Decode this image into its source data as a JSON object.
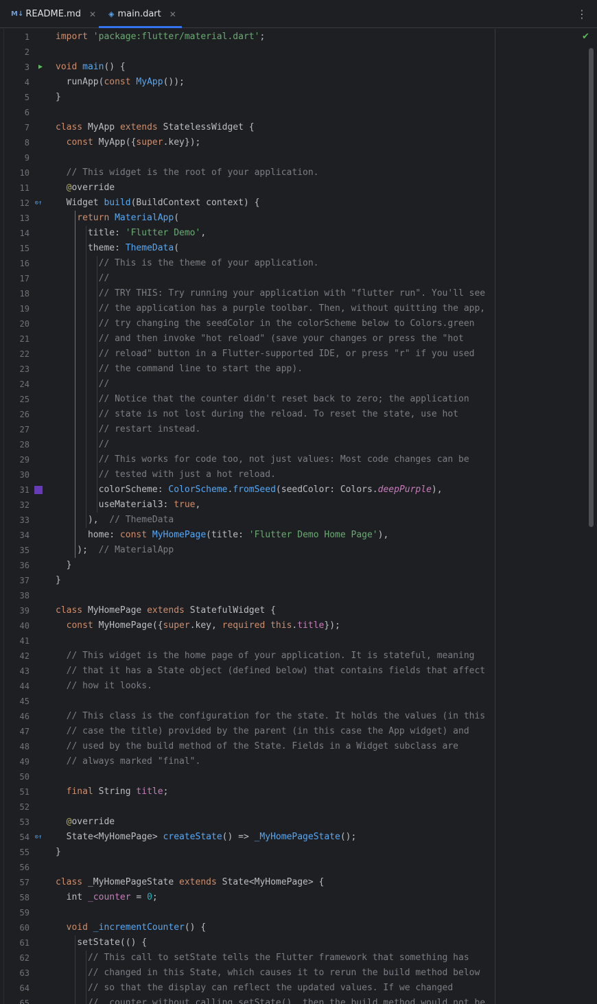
{
  "tabs": [
    {
      "icon": "M↓",
      "label": "README.md",
      "active": false
    },
    {
      "icon": "◈",
      "label": "main.dart",
      "active": true
    }
  ],
  "colors": {
    "accent": "#3574f0",
    "background": "#1e1f22",
    "swatch": "#673ab7"
  },
  "lines": [
    {
      "n": "1",
      "t": [
        [
          "kw",
          "import "
        ],
        [
          "str",
          "'package:flutter/material.dart'"
        ],
        [
          "",
          "; "
        ]
      ]
    },
    {
      "n": "2",
      "t": []
    },
    {
      "n": "3",
      "m": "run",
      "t": [
        [
          "kw",
          "void "
        ],
        [
          "fn",
          "main"
        ],
        [
          "",
          "() {"
        ]
      ]
    },
    {
      "n": "4",
      "t": [
        [
          "",
          "  runApp("
        ],
        [
          "kw",
          "const "
        ],
        [
          "fn",
          "MyApp"
        ],
        [
          "",
          "());"
        ]
      ]
    },
    {
      "n": "5",
      "t": [
        [
          "",
          "}"
        ]
      ]
    },
    {
      "n": "6",
      "t": []
    },
    {
      "n": "7",
      "t": [
        [
          "kw",
          "class "
        ],
        [
          "",
          "MyApp "
        ],
        [
          "kw",
          "extends "
        ],
        [
          "",
          "StatelessWidget {"
        ]
      ]
    },
    {
      "n": "8",
      "t": [
        [
          "kw",
          "  const "
        ],
        [
          "",
          "MyApp({"
        ],
        [
          "kw",
          "super"
        ],
        [
          "",
          ".key});"
        ]
      ]
    },
    {
      "n": "9",
      "t": []
    },
    {
      "n": "10",
      "t": [
        [
          "cm",
          "  // This widget is the root of your application."
        ]
      ]
    },
    {
      "n": "11",
      "t": [
        [
          "ann",
          "  @"
        ],
        [
          "",
          "override"
        ]
      ]
    },
    {
      "n": "12",
      "m": "override",
      "t": [
        [
          "",
          "  Widget "
        ],
        [
          "fn",
          "build"
        ],
        [
          "",
          "(BuildContext context) {"
        ]
      ]
    },
    {
      "n": "13",
      "t": [
        [
          "kw",
          "    return "
        ],
        [
          "fn",
          "MaterialApp"
        ],
        [
          "",
          "("
        ]
      ]
    },
    {
      "n": "14",
      "t": [
        [
          "",
          "      title: "
        ],
        [
          "str",
          "'Flutter Demo'"
        ],
        [
          "",
          ","
        ]
      ]
    },
    {
      "n": "15",
      "t": [
        [
          "",
          "      theme: "
        ],
        [
          "fn",
          "ThemeData"
        ],
        [
          "",
          "("
        ]
      ]
    },
    {
      "n": "16",
      "t": [
        [
          "cm",
          "        // This is the theme of your application."
        ]
      ]
    },
    {
      "n": "17",
      "t": [
        [
          "cm",
          "        //"
        ]
      ]
    },
    {
      "n": "18",
      "t": [
        [
          "cm",
          "        // TRY THIS: Try running your application with \"flutter run\". You'll see"
        ]
      ]
    },
    {
      "n": "19",
      "t": [
        [
          "cm",
          "        // the application has a purple toolbar. Then, without quitting the app,"
        ]
      ]
    },
    {
      "n": "20",
      "t": [
        [
          "cm",
          "        // try changing the seedColor in the colorScheme below to Colors.green"
        ]
      ]
    },
    {
      "n": "21",
      "t": [
        [
          "cm",
          "        // and then invoke \"hot reload\" (save your changes or press the \"hot"
        ]
      ]
    },
    {
      "n": "22",
      "t": [
        [
          "cm",
          "        // reload\" button in a Flutter-supported IDE, or press \"r\" if you used"
        ]
      ]
    },
    {
      "n": "23",
      "t": [
        [
          "cm",
          "        // the command line to start the app)."
        ]
      ]
    },
    {
      "n": "24",
      "t": [
        [
          "cm",
          "        //"
        ]
      ]
    },
    {
      "n": "25",
      "t": [
        [
          "cm",
          "        // Notice that the counter didn't reset back to zero; the application"
        ]
      ]
    },
    {
      "n": "26",
      "t": [
        [
          "cm",
          "        // state is not lost during the reload. To reset the state, use hot"
        ]
      ]
    },
    {
      "n": "27",
      "t": [
        [
          "cm",
          "        // restart instead."
        ]
      ]
    },
    {
      "n": "28",
      "t": [
        [
          "cm",
          "        //"
        ]
      ]
    },
    {
      "n": "29",
      "t": [
        [
          "cm",
          "        // This works for code too, not just values: Most code changes can be"
        ]
      ]
    },
    {
      "n": "30",
      "t": [
        [
          "cm",
          "        // tested with just a hot reload."
        ]
      ]
    },
    {
      "n": "31",
      "m": "swatch",
      "t": [
        [
          "",
          "        colorScheme: "
        ],
        [
          "fn",
          "ColorScheme"
        ],
        [
          "",
          "."
        ],
        [
          "fn",
          "fromSeed"
        ],
        [
          "",
          "(seedColor: Colors."
        ],
        [
          "it",
          "deepPurple"
        ],
        [
          "",
          "),"
        ]
      ]
    },
    {
      "n": "32",
      "t": [
        [
          "",
          "        useMaterial3: "
        ],
        [
          "kw",
          "true"
        ],
        [
          "",
          ","
        ]
      ]
    },
    {
      "n": "33",
      "t": [
        [
          "",
          "      ),  "
        ],
        [
          "cm",
          "// ThemeData"
        ]
      ]
    },
    {
      "n": "34",
      "t": [
        [
          "",
          "      home: "
        ],
        [
          "kw",
          "const "
        ],
        [
          "fn",
          "MyHomePage"
        ],
        [
          "",
          "(title: "
        ],
        [
          "str",
          "'Flutter Demo Home Page'"
        ],
        [
          "",
          "),"
        ]
      ]
    },
    {
      "n": "35",
      "t": [
        [
          "",
          "    );  "
        ],
        [
          "cm",
          "// MaterialApp"
        ]
      ]
    },
    {
      "n": "36",
      "t": [
        [
          "",
          "  }"
        ]
      ]
    },
    {
      "n": "37",
      "t": [
        [
          "",
          "}"
        ]
      ]
    },
    {
      "n": "38",
      "t": []
    },
    {
      "n": "39",
      "t": [
        [
          "kw",
          "class "
        ],
        [
          "",
          "MyHomePage "
        ],
        [
          "kw",
          "extends "
        ],
        [
          "",
          "StatefulWidget {"
        ]
      ]
    },
    {
      "n": "40",
      "t": [
        [
          "kw",
          "  const "
        ],
        [
          "",
          "MyHomePage({"
        ],
        [
          "kw",
          "super"
        ],
        [
          "",
          ".key, "
        ],
        [
          "kw",
          "required this"
        ],
        [
          "",
          "."
        ],
        [
          "prop",
          "title"
        ],
        [
          "",
          "});"
        ]
      ]
    },
    {
      "n": "41",
      "t": []
    },
    {
      "n": "42",
      "t": [
        [
          "cm",
          "  // This widget is the home page of your application. It is stateful, meaning"
        ]
      ]
    },
    {
      "n": "43",
      "t": [
        [
          "cm",
          "  // that it has a State object (defined below) that contains fields that affect"
        ]
      ]
    },
    {
      "n": "44",
      "t": [
        [
          "cm",
          "  // how it looks."
        ]
      ]
    },
    {
      "n": "45",
      "t": []
    },
    {
      "n": "46",
      "t": [
        [
          "cm",
          "  // This class is the configuration for the state. It holds the values (in this"
        ]
      ]
    },
    {
      "n": "47",
      "t": [
        [
          "cm",
          "  // case the title) provided by the parent (in this case the App widget) and"
        ]
      ]
    },
    {
      "n": "48",
      "t": [
        [
          "cm",
          "  // used by the build method of the State. Fields in a Widget subclass are"
        ]
      ]
    },
    {
      "n": "49",
      "t": [
        [
          "cm",
          "  // always marked \"final\"."
        ]
      ]
    },
    {
      "n": "50",
      "t": []
    },
    {
      "n": "51",
      "t": [
        [
          "kw",
          "  final "
        ],
        [
          "",
          "String "
        ],
        [
          "prop",
          "title"
        ],
        [
          "",
          ";"
        ]
      ]
    },
    {
      "n": "52",
      "t": []
    },
    {
      "n": "53",
      "t": [
        [
          "ann",
          "  @"
        ],
        [
          "",
          "override"
        ]
      ]
    },
    {
      "n": "54",
      "m": "override",
      "t": [
        [
          "",
          "  State<MyHomePage> "
        ],
        [
          "fn",
          "createState"
        ],
        [
          "",
          "() => "
        ],
        [
          "fn",
          "_MyHomePageState"
        ],
        [
          "",
          "();"
        ]
      ]
    },
    {
      "n": "55",
      "t": [
        [
          "",
          "}"
        ]
      ]
    },
    {
      "n": "56",
      "t": []
    },
    {
      "n": "57",
      "t": [
        [
          "kw",
          "class "
        ],
        [
          "",
          "_MyHomePageState "
        ],
        [
          "kw",
          "extends "
        ],
        [
          "",
          "State<MyHomePage> {"
        ]
      ]
    },
    {
      "n": "58",
      "t": [
        [
          "",
          "  int "
        ],
        [
          "prop",
          "_counter"
        ],
        [
          "",
          " = "
        ],
        [
          "num",
          "0"
        ],
        [
          "",
          ";"
        ]
      ]
    },
    {
      "n": "59",
      "t": []
    },
    {
      "n": "60",
      "t": [
        [
          "kw",
          "  void "
        ],
        [
          "fn",
          "_incrementCounter"
        ],
        [
          "",
          "() {"
        ]
      ]
    },
    {
      "n": "61",
      "t": [
        [
          "",
          "    setState(() {"
        ]
      ]
    },
    {
      "n": "62",
      "t": [
        [
          "cm",
          "      // This call to setState tells the Flutter framework that something has"
        ]
      ]
    },
    {
      "n": "63",
      "t": [
        [
          "cm",
          "      // changed in this State, which causes it to rerun the build method below"
        ]
      ]
    },
    {
      "n": "64",
      "t": [
        [
          "cm",
          "      // so that the display can reflect the updated values. If we changed"
        ]
      ]
    },
    {
      "n": "65",
      "t": [
        [
          "cm",
          "      // _counter without calling setState(), then the build method would not be"
        ]
      ]
    }
  ]
}
